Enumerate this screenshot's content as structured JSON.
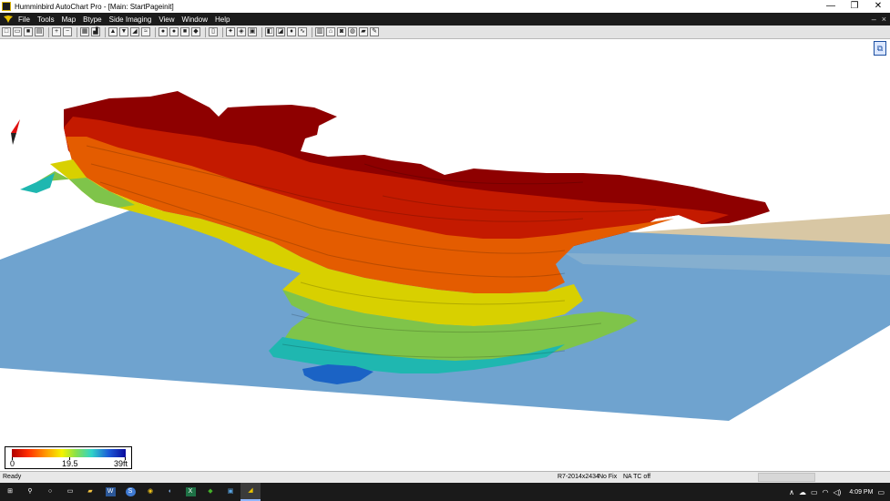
{
  "window": {
    "title": "Humminbird AutoChart Pro - [Main: StartPageinit]",
    "minimize": "—",
    "maximize": "❐",
    "close": "✕"
  },
  "menubar": {
    "items": [
      {
        "label": "File"
      },
      {
        "label": "Tools"
      },
      {
        "label": "Map"
      },
      {
        "label": "Btype"
      },
      {
        "label": "Side Imaging"
      },
      {
        "label": "View"
      },
      {
        "label": "Window"
      },
      {
        "label": "Help"
      }
    ],
    "mdi_minimize": "–",
    "mdi_close": "×"
  },
  "toolbar": {
    "buttons": [
      {
        "icon": "new-file-icon",
        "glyph": "□"
      },
      {
        "icon": "open-folder-icon",
        "glyph": "▭"
      },
      {
        "icon": "save-icon",
        "glyph": "■"
      },
      {
        "icon": "print-icon",
        "glyph": "▤"
      },
      {
        "icon": "zoom-in-icon",
        "glyph": "+"
      },
      {
        "icon": "zoom-out-icon",
        "glyph": "−"
      },
      {
        "icon": "map-view-icon",
        "glyph": "▦"
      },
      {
        "icon": "chart-view-icon",
        "glyph": "▟"
      },
      {
        "icon": "depth-up-icon",
        "glyph": "▲"
      },
      {
        "icon": "depth-down-icon",
        "glyph": "▼"
      },
      {
        "icon": "shade-icon",
        "glyph": "◢"
      },
      {
        "icon": "contour-icon",
        "glyph": "≈"
      },
      {
        "icon": "circle-dark-icon",
        "glyph": "●"
      },
      {
        "icon": "circle-gray-icon",
        "glyph": "●"
      },
      {
        "icon": "square-gray-icon",
        "glyph": "■"
      },
      {
        "icon": "cube-3d-icon",
        "glyph": "◆"
      },
      {
        "icon": "page-icon",
        "glyph": "▯"
      },
      {
        "icon": "tools-icon",
        "glyph": "✦"
      },
      {
        "icon": "shield-icon",
        "glyph": "◈"
      },
      {
        "icon": "layer-icon",
        "glyph": "▣"
      },
      {
        "icon": "palette-icon",
        "glyph": "◧"
      },
      {
        "icon": "color-map-icon",
        "glyph": "◪"
      },
      {
        "icon": "pin-icon",
        "glyph": "♦"
      },
      {
        "icon": "track-icon",
        "glyph": "∿"
      },
      {
        "icon": "grid-icon",
        "glyph": "▥"
      },
      {
        "icon": "boat-icon",
        "glyph": "⌂"
      },
      {
        "icon": "camera-icon",
        "glyph": "◙"
      },
      {
        "icon": "chart-settings-icon",
        "glyph": "◍"
      },
      {
        "icon": "export-icon",
        "glyph": "▰"
      },
      {
        "icon": "pencil-icon",
        "glyph": "✎"
      }
    ]
  },
  "view_toggle": {
    "glyph": "⧉"
  },
  "legend": {
    "min_label": "0",
    "mid_label": "19.5",
    "max_label": "39ft"
  },
  "statusbar": {
    "ready": "Ready",
    "file": "R7-2014x2434",
    "fix": "No Fix",
    "tc": "NA  TC off"
  },
  "taskbar": {
    "apps": [
      {
        "icon": "windows-start-icon",
        "glyph": "⊞",
        "active": false
      },
      {
        "icon": "search-icon",
        "glyph": "⚲",
        "active": false
      },
      {
        "icon": "cortana-icon",
        "glyph": "○",
        "active": false
      },
      {
        "icon": "task-view-icon",
        "glyph": "▭",
        "active": false
      },
      {
        "icon": "file-explorer-icon",
        "glyph": "▰",
        "active": false
      },
      {
        "icon": "word-icon",
        "glyph": "W",
        "active": false
      },
      {
        "icon": "skype-icon",
        "glyph": "S",
        "active": false
      },
      {
        "icon": "chrome-icon",
        "glyph": "◉",
        "active": false
      },
      {
        "icon": "browser-icon",
        "glyph": "◐",
        "active": false
      },
      {
        "icon": "excel-icon",
        "glyph": "X",
        "active": false
      },
      {
        "icon": "app-green-icon",
        "glyph": "◆",
        "active": false
      },
      {
        "icon": "app-blue-icon",
        "glyph": "▣",
        "active": false
      },
      {
        "icon": "autochart-icon",
        "glyph": "◢",
        "active": true
      }
    ],
    "tray": {
      "chevron": "∧",
      "cloud": "☁",
      "network": "▭",
      "wifi": "◠",
      "volume": "◁)",
      "clock": "4:09 PM",
      "notifications": "▭"
    }
  },
  "colors": {
    "menubar_bg": "#1b1b1b",
    "water_blue": "#6fa3cf",
    "land_tan": "#d8c7a4",
    "deep_red": "#8e0000",
    "red": "#c41a00",
    "orange": "#e45c00",
    "yellow": "#d8d000",
    "green": "#7fc44a",
    "teal": "#1fb7b0",
    "blue": "#1b63c5"
  }
}
